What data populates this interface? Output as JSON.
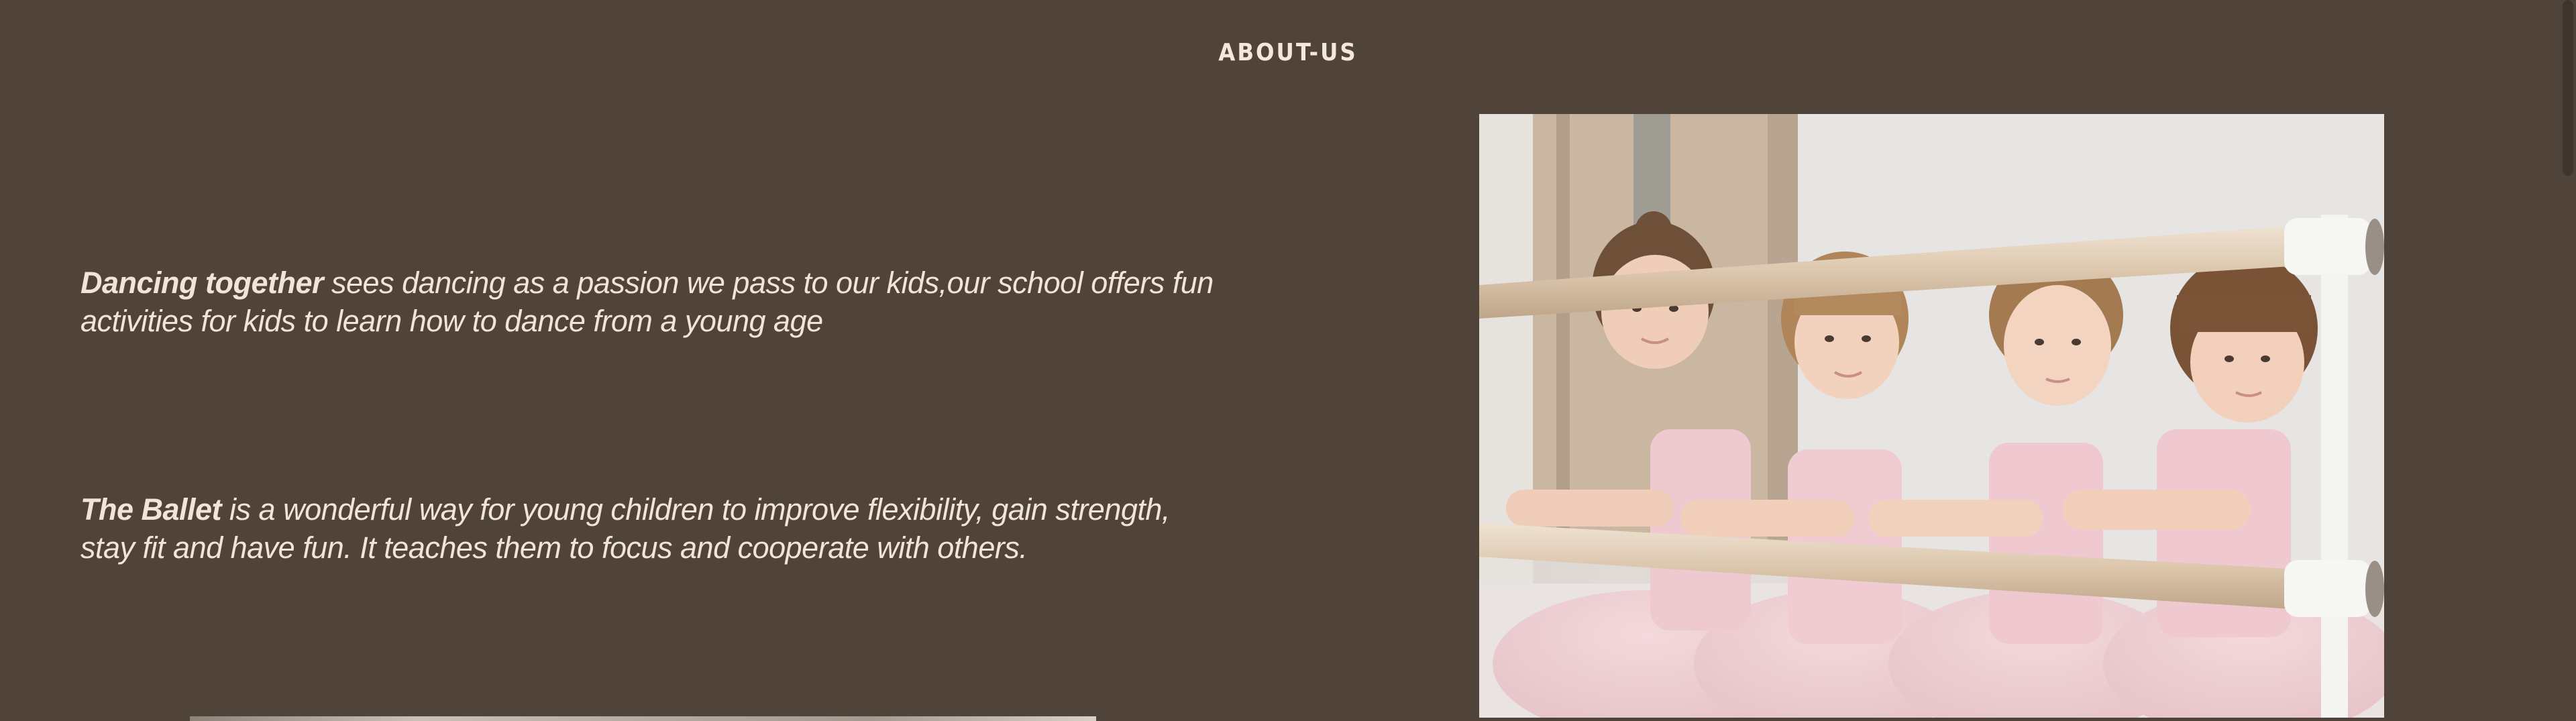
{
  "about": {
    "title": "ABOUT-US",
    "paragraph_1": {
      "lead": "Dancing together",
      "body": " sees dancing as a passion we pass to our kids,our school offers fun activities for kids to learn how to dance from a young age"
    },
    "paragraph_2": {
      "lead": "The Ballet",
      "body": " is a wonderful way for young children to improve flexibility, gain strength, stay fit and have fun. It teaches them to focus and cooperate with others."
    }
  },
  "colors": {
    "background": "#50443a",
    "text": "#f1e5d8",
    "title": "#f4e8dc"
  }
}
